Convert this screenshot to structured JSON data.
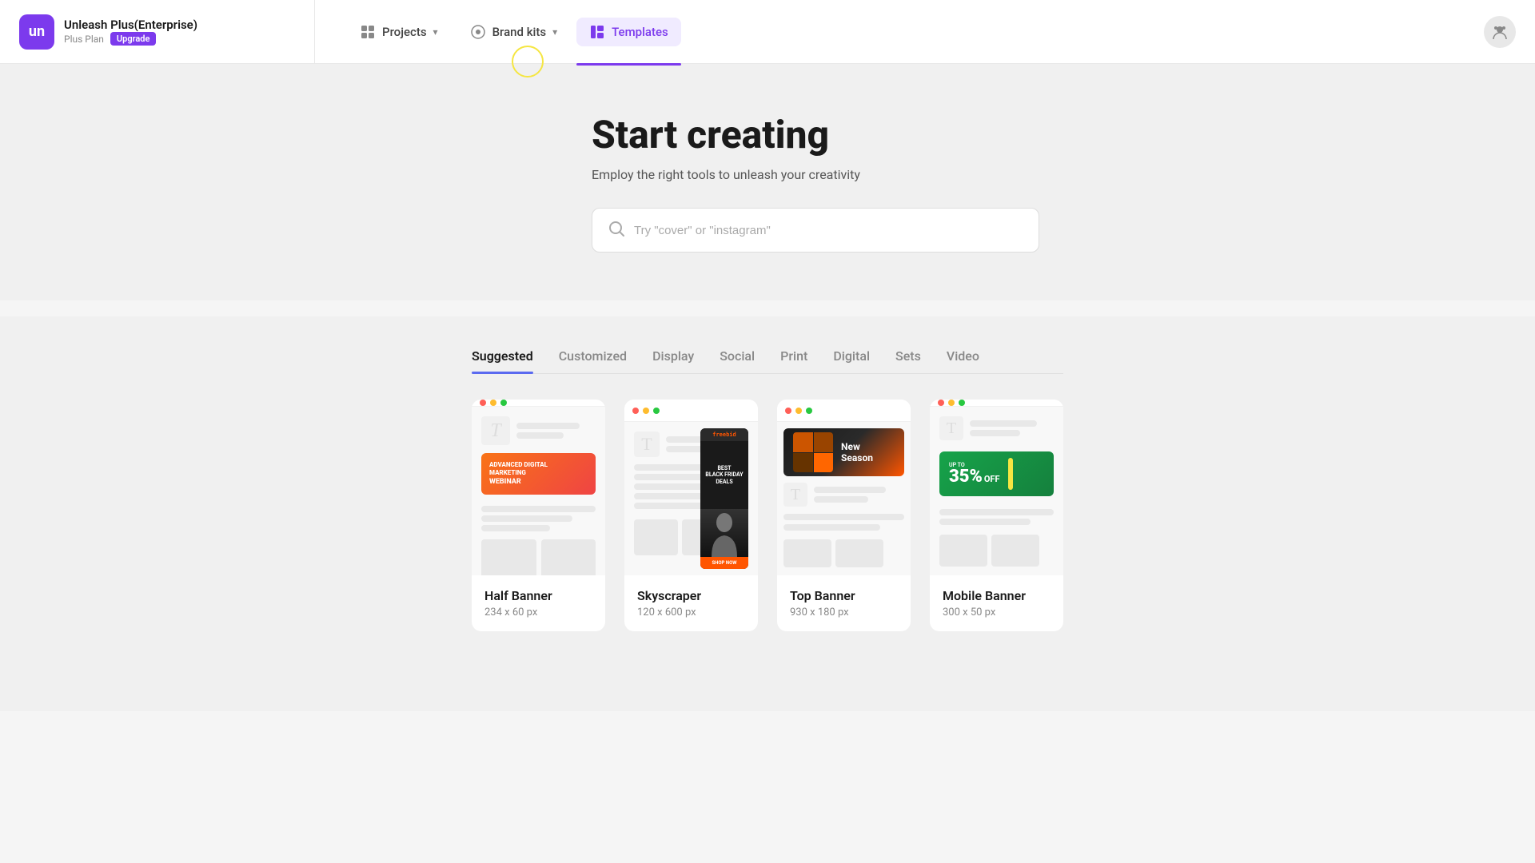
{
  "app": {
    "logo_initials": "un",
    "title": "Unleash Plus(Enterprise)",
    "plan": "Plus Plan",
    "upgrade_label": "Upgrade"
  },
  "nav": {
    "projects_label": "Projects",
    "brand_kits_label": "Brand kits",
    "templates_label": "Templates",
    "projects_icon": "⊞",
    "brand_kits_icon": "◉"
  },
  "hero": {
    "title": "Start creating",
    "subtitle": "Employ the right tools to unleash your creativity",
    "search_placeholder": "Try \"cover\" or \"instagram\""
  },
  "tabs": [
    {
      "label": "Suggested",
      "active": true
    },
    {
      "label": "Customized",
      "active": false
    },
    {
      "label": "Display",
      "active": false
    },
    {
      "label": "Social",
      "active": false
    },
    {
      "label": "Print",
      "active": false
    },
    {
      "label": "Digital",
      "active": false
    },
    {
      "label": "Sets",
      "active": false
    },
    {
      "label": "Video",
      "active": false
    }
  ],
  "templates": [
    {
      "name": "Half Banner",
      "size": "234 x 60 px",
      "type": "half-banner"
    },
    {
      "name": "Skyscraper",
      "size": "120 x 600 px",
      "type": "skyscraper"
    },
    {
      "name": "Top Banner",
      "size": "930 x 180 px",
      "type": "top-banner"
    },
    {
      "name": "Mobile Banner",
      "size": "300 x 50 px",
      "type": "mobile-banner"
    }
  ],
  "banner_ad": {
    "text": "ADVANCED DIGITAL\nMARKETING\nWEBINAR"
  },
  "skyscraper_ad": {
    "logo": "freebid",
    "headline": "BEST\nBLACK FRIDAY\nDEALS",
    "cta": "SHOP NOW"
  },
  "top_banner_ad": {
    "text": "New\nSeason"
  },
  "mobile_banner_ad": {
    "prefix": "UP TO",
    "percent": "35%",
    "suffix": "OFF"
  },
  "colors": {
    "primary": "#7c3aed",
    "active_tab": "#5b6af0",
    "nav_active_bg": "#f0ebff"
  }
}
